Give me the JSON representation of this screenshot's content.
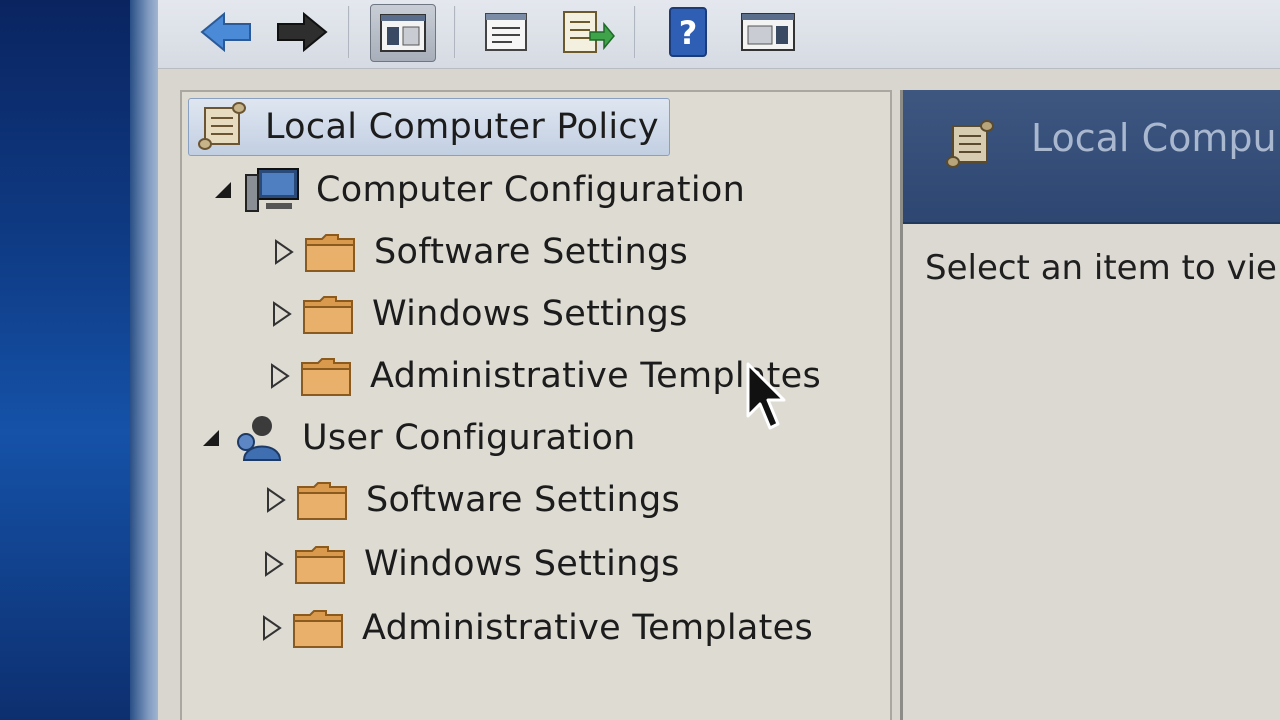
{
  "toolbar": {
    "buttons": [
      {
        "name": "back",
        "icon": "back-arrow-icon"
      },
      {
        "name": "forward",
        "icon": "forward-arrow-icon"
      },
      {
        "name": "show-hide-console-tree",
        "icon": "console-tree-icon"
      },
      {
        "name": "properties",
        "icon": "properties-icon"
      },
      {
        "name": "export-list",
        "icon": "export-list-icon"
      },
      {
        "name": "help",
        "icon": "help-icon"
      },
      {
        "name": "show-hide-action-pane",
        "icon": "action-pane-icon"
      }
    ]
  },
  "tree": {
    "root": {
      "label": "Local Computer Policy",
      "selected": true
    },
    "computer_configuration": {
      "label": "Computer Configuration",
      "expanded": true,
      "children": [
        {
          "label": "Software Settings"
        },
        {
          "label": "Windows Settings"
        },
        {
          "label": "Administrative Templates"
        }
      ]
    },
    "user_configuration": {
      "label": "User Configuration",
      "expanded": true,
      "children": [
        {
          "label": "Software Settings"
        },
        {
          "label": "Windows Settings"
        },
        {
          "label": "Administrative Templates"
        }
      ]
    }
  },
  "details": {
    "header_title": "Local Compu",
    "hint": "Select an item to vie"
  },
  "colors": {
    "selection": "#c2cfe2",
    "header": "#2d4772",
    "folder": "#d99a4e"
  }
}
